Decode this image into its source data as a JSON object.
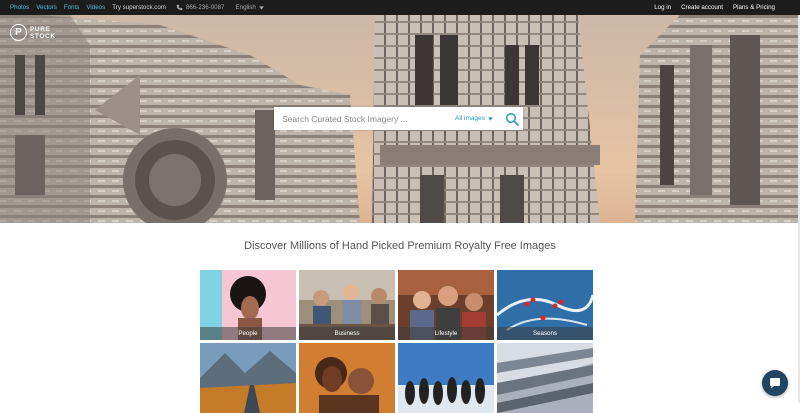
{
  "topbar": {
    "nav": [
      "Photos",
      "Vectors",
      "Fonts",
      "Videos"
    ],
    "external_link": "Try superstock.com",
    "phone": "866-236-0087",
    "language": "English",
    "account_links": [
      "Log in",
      "Create account",
      "Plans & Pricing"
    ]
  },
  "logo": {
    "letter": "P",
    "line1": "PURE",
    "line2": "STOCK"
  },
  "search": {
    "placeholder": "Search Curated Stock Imagery ...",
    "filter_label": "All images"
  },
  "tagline": "Discover Millions of Hand Picked Premium Royalty Free Images",
  "categories": [
    {
      "label": "People"
    },
    {
      "label": "Business"
    },
    {
      "label": "Lifestyle"
    },
    {
      "label": "Seasons"
    },
    {
      "label": ""
    },
    {
      "label": ""
    },
    {
      "label": ""
    },
    {
      "label": ""
    }
  ],
  "colors": {
    "topbar": "#1c1c1c",
    "accent": "#2a9bc4",
    "link": "#4fc3d9",
    "chat": "#1f4561"
  },
  "icons": {
    "phone": "phone-icon",
    "search": "search-icon",
    "chat": "chat-icon",
    "dropdown": "caret-down-icon"
  }
}
